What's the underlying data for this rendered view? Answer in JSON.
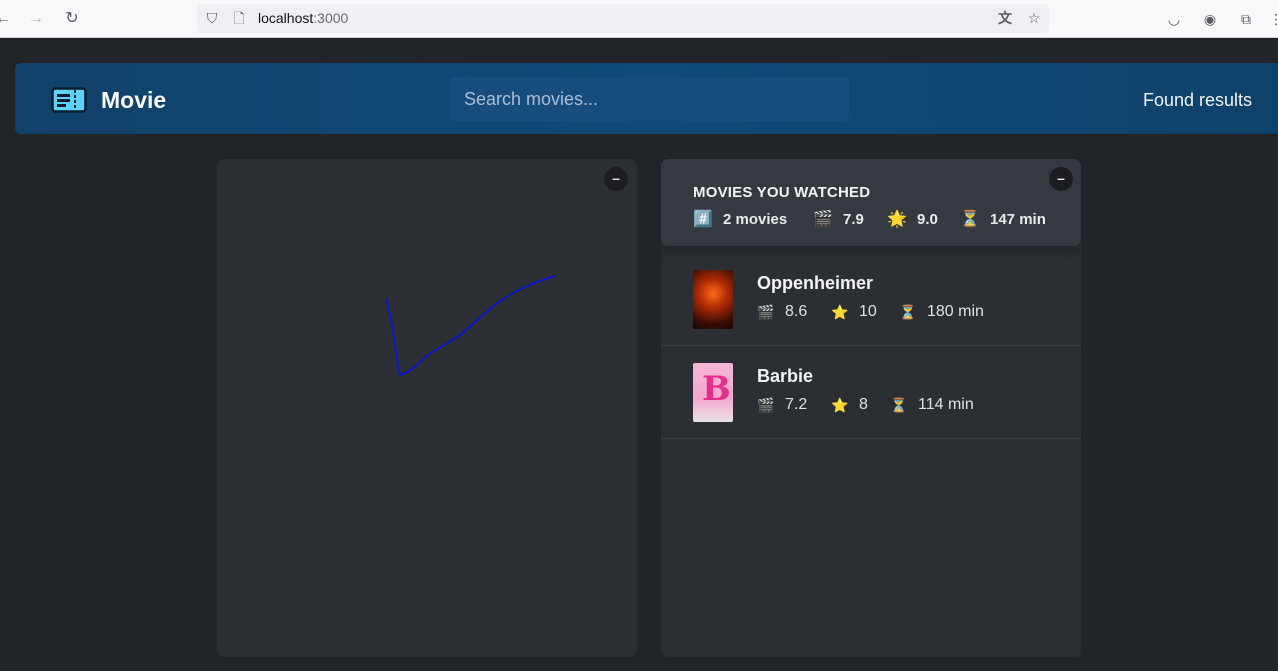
{
  "browser": {
    "url_host": "localhost",
    "url_port": ":3000"
  },
  "nav": {
    "logo_icon": "ticket-icon",
    "logo_text": "Movie",
    "search_placeholder": "Search movies...",
    "found_text": "Found results"
  },
  "left_box": {
    "toggle_label": "–"
  },
  "summary": {
    "toggle_label": "–",
    "title": "MOVIES YOU WATCHED",
    "stats": [
      {
        "icon": "#️⃣",
        "value": "2 movies"
      },
      {
        "icon": "🎬",
        "value": "7.9"
      },
      {
        "icon": "🌟",
        "value": "9.0"
      },
      {
        "icon": "⏳",
        "value": "147 min"
      }
    ]
  },
  "watched": [
    {
      "title": "Oppenheimer",
      "imdb": "8.6",
      "user": "10",
      "runtime": "180 min"
    },
    {
      "title": "Barbie",
      "imdb": "7.2",
      "user": "8",
      "runtime": "114 min"
    }
  ],
  "stat_icons": {
    "imdb": "🎬",
    "user": "⭐",
    "runtime": "⏳"
  },
  "colors": {
    "navbar": "#10416a",
    "box": "#2b2f34",
    "summary": "#343a40",
    "background": "#212529"
  }
}
